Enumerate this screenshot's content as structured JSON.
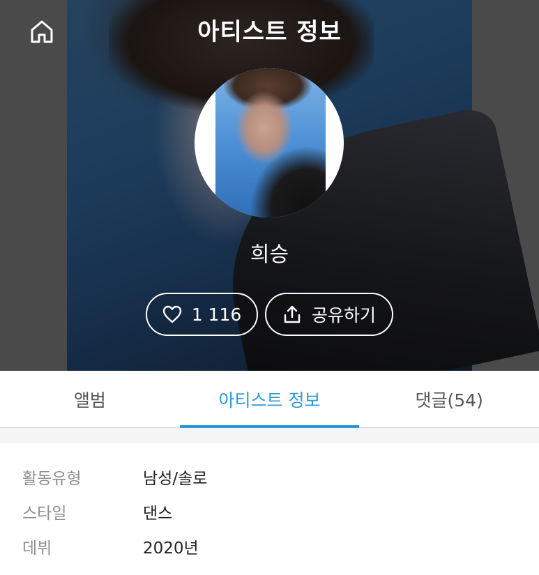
{
  "header": {
    "title": "아티스트 정보",
    "home_icon": "home-icon"
  },
  "artist": {
    "name": "희승"
  },
  "actions": {
    "like_count": "1 116",
    "like_icon": "heart-icon",
    "share_label": "공유하기",
    "share_icon": "share-icon"
  },
  "tabs": [
    {
      "label": "앨범",
      "active": false
    },
    {
      "label": "아티스트 정보",
      "active": true
    },
    {
      "label": "댓글(54)",
      "active": false
    }
  ],
  "info": [
    {
      "key": "활동유형",
      "value": "남성/솔로"
    },
    {
      "key": "스타일",
      "value": "댄스"
    },
    {
      "key": "데뷔",
      "value": "2020년"
    }
  ],
  "colors": {
    "accent": "#2b9ad6",
    "label_gray": "#8f8f8f"
  }
}
